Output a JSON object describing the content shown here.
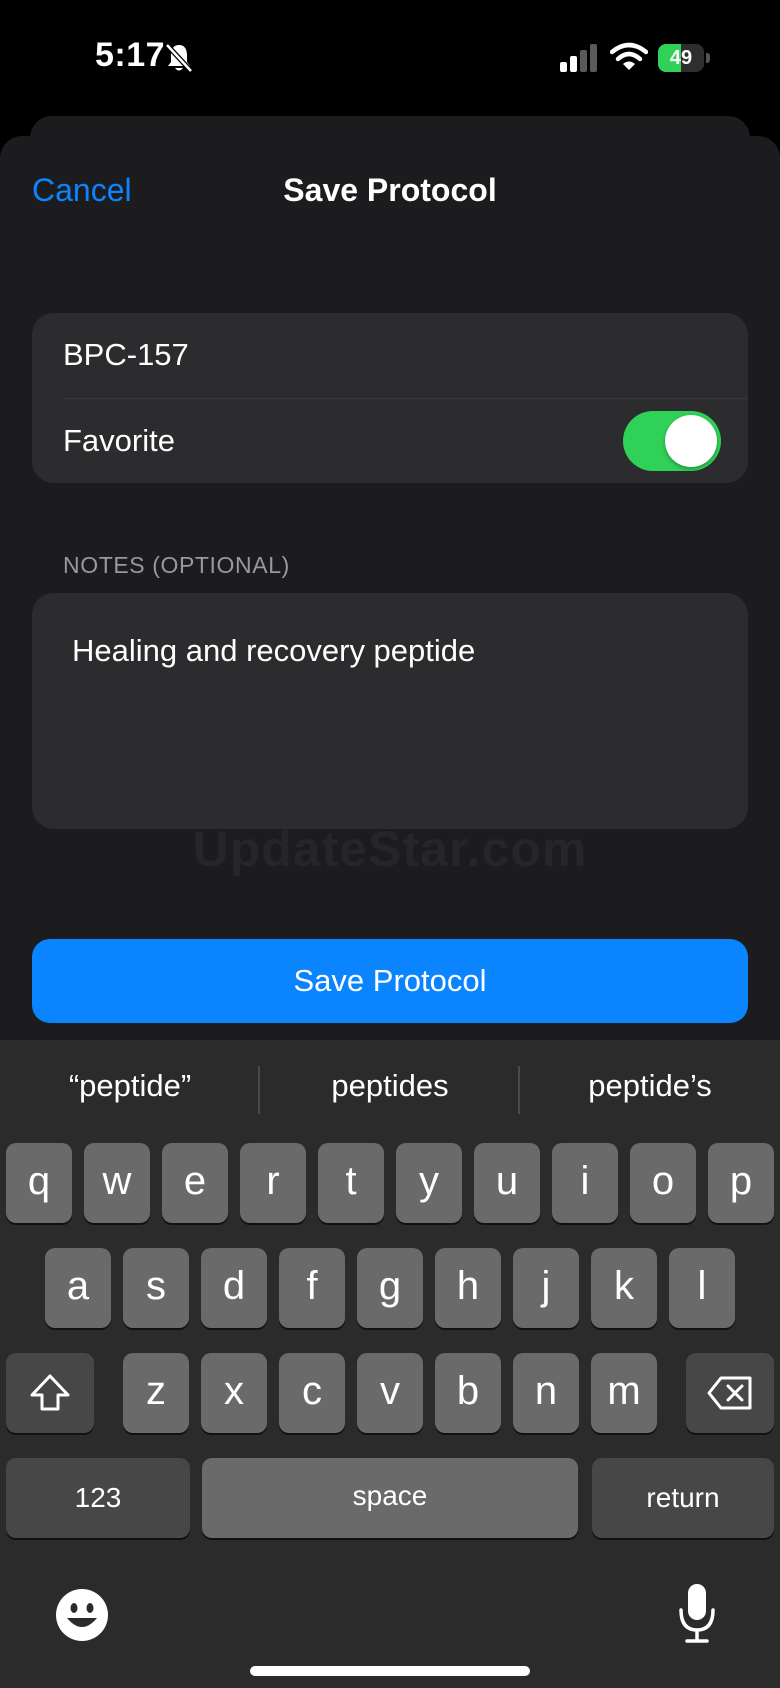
{
  "status_bar": {
    "time": "5:17",
    "battery": "49",
    "battery_level": 0.49
  },
  "nav": {
    "cancel_label": "Cancel",
    "title": "Save Protocol"
  },
  "form": {
    "name_value": "BPC-157",
    "favorite_label": "Favorite",
    "favorite_on": true,
    "notes_header": "NOTES (OPTIONAL)",
    "notes_value": "Healing and recovery peptide"
  },
  "watermark": "UpdateStar.com",
  "save_button_label": "Save Protocol",
  "keyboard": {
    "suggestions": [
      "“peptide”",
      "peptides",
      "peptide’s"
    ],
    "row1": [
      "q",
      "w",
      "e",
      "r",
      "t",
      "y",
      "u",
      "i",
      "o",
      "p"
    ],
    "row2": [
      "a",
      "s",
      "d",
      "f",
      "g",
      "h",
      "j",
      "k",
      "l"
    ],
    "row3": [
      "z",
      "x",
      "c",
      "v",
      "b",
      "n",
      "m"
    ],
    "numbers_label": "123",
    "space_label": "space",
    "return_label": "return"
  },
  "colors": {
    "accent": "#0a84ff",
    "toggle_on": "#30d158",
    "background": "#1c1c1e",
    "cell": "#2c2c2e"
  },
  "icons": [
    "bell-slash-icon",
    "signal-icon",
    "wifi-icon",
    "battery-icon",
    "shift-icon",
    "delete-icon",
    "emoji-icon",
    "microphone-icon"
  ]
}
